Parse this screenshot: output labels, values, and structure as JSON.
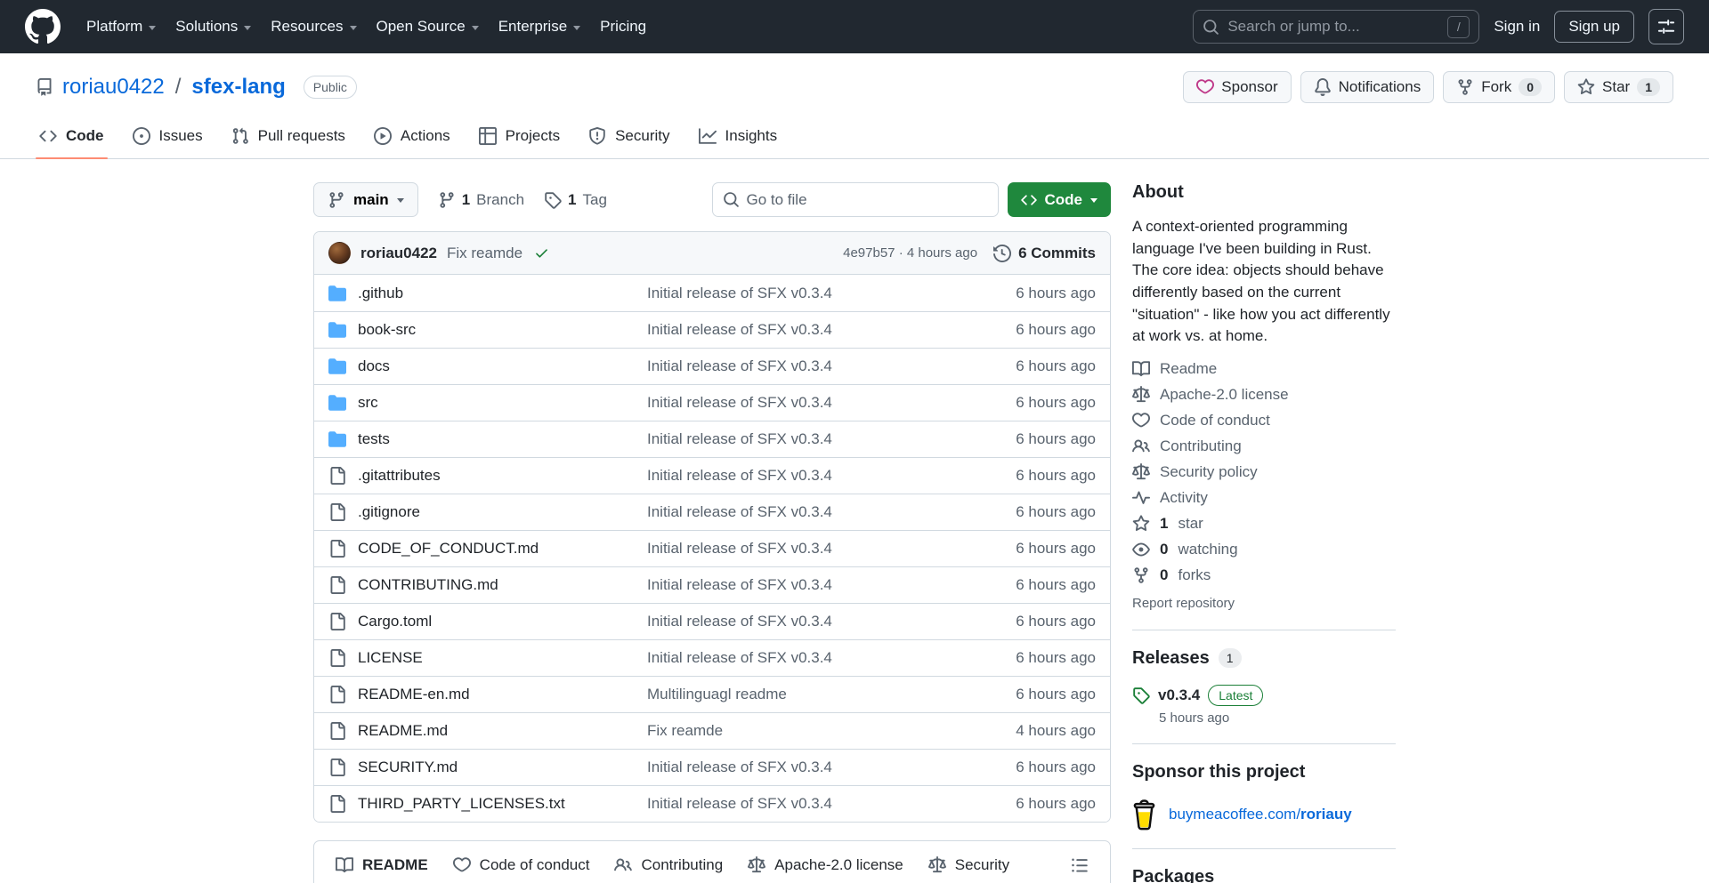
{
  "colors": {
    "header_bg": "#212830",
    "link_blue": "#0969da",
    "accent_green": "#1f883d",
    "success_green": "#1a7f37",
    "underline_orange": "#fd8c73",
    "folder_blue": "#54aeff",
    "sponsor_pink": "#bf3989",
    "coffee_yellow": "#ffdd00",
    "border_gray": "#d1d9e0",
    "muted_text": "#59636e"
  },
  "header": {
    "nav": [
      "Platform",
      "Solutions",
      "Resources",
      "Open Source",
      "Enterprise",
      "Pricing"
    ],
    "search_placeholder": "Search or jump to...",
    "search_shortcut": "/",
    "sign_in": "Sign in",
    "sign_up": "Sign up"
  },
  "repo_header": {
    "owner": "roriau0422",
    "slash": "/",
    "name": "sfex-lang",
    "visibility": "Public",
    "sponsor": "Sponsor",
    "notifications": "Notifications",
    "fork": "Fork",
    "fork_count": "0",
    "star": "Star",
    "star_count": "1"
  },
  "repo_tabs": [
    {
      "label": "Code"
    },
    {
      "label": "Issues"
    },
    {
      "label": "Pull requests"
    },
    {
      "label": "Actions"
    },
    {
      "label": "Projects"
    },
    {
      "label": "Security"
    },
    {
      "label": "Insights"
    }
  ],
  "toolbar": {
    "branch": "main",
    "branches_count": "1",
    "branches_label": "Branch",
    "tags_count": "1",
    "tags_label": "Tag",
    "go_to_file_placeholder": "Go to file",
    "code_button": "Code"
  },
  "commit_bar": {
    "author": "roriau0422",
    "message": "Fix reamde",
    "meta": "4e97b57 · 4 hours ago",
    "commits": "6 Commits"
  },
  "files": [
    {
      "name": ".github",
      "type": "folder",
      "message": "Initial release of SFX v0.3.4",
      "time": "6 hours ago"
    },
    {
      "name": "book-src",
      "type": "folder",
      "message": "Initial release of SFX v0.3.4",
      "time": "6 hours ago"
    },
    {
      "name": "docs",
      "type": "folder",
      "message": "Initial release of SFX v0.3.4",
      "time": "6 hours ago"
    },
    {
      "name": "src",
      "type": "folder",
      "message": "Initial release of SFX v0.3.4",
      "time": "6 hours ago"
    },
    {
      "name": "tests",
      "type": "folder",
      "message": "Initial release of SFX v0.3.4",
      "time": "6 hours ago"
    },
    {
      "name": ".gitattributes",
      "type": "file",
      "message": "Initial release of SFX v0.3.4",
      "time": "6 hours ago"
    },
    {
      "name": ".gitignore",
      "type": "file",
      "message": "Initial release of SFX v0.3.4",
      "time": "6 hours ago"
    },
    {
      "name": "CODE_OF_CONDUCT.md",
      "type": "file",
      "message": "Initial release of SFX v0.3.4",
      "time": "6 hours ago"
    },
    {
      "name": "CONTRIBUTING.md",
      "type": "file",
      "message": "Initial release of SFX v0.3.4",
      "time": "6 hours ago"
    },
    {
      "name": "Cargo.toml",
      "type": "file",
      "message": "Initial release of SFX v0.3.4",
      "time": "6 hours ago"
    },
    {
      "name": "LICENSE",
      "type": "file",
      "message": "Initial release of SFX v0.3.4",
      "time": "6 hours ago"
    },
    {
      "name": "README-en.md",
      "type": "file",
      "message": "Multilinguagl readme",
      "time": "6 hours ago"
    },
    {
      "name": "README.md",
      "type": "file",
      "message": "Fix reamde",
      "time": "4 hours ago"
    },
    {
      "name": "SECURITY.md",
      "type": "file",
      "message": "Initial release of SFX v0.3.4",
      "time": "6 hours ago"
    },
    {
      "name": "THIRD_PARTY_LICENSES.txt",
      "type": "file",
      "message": "Initial release of SFX v0.3.4",
      "time": "6 hours ago"
    }
  ],
  "readme_tabs": [
    {
      "label": "README"
    },
    {
      "label": "Code of conduct"
    },
    {
      "label": "Contributing"
    },
    {
      "label": "Apache-2.0 license"
    },
    {
      "label": "Security"
    }
  ],
  "sidebar": {
    "about_title": "About",
    "description": "A context-oriented programming language I've been building in Rust. The core idea: objects should behave differently based on the current \"situation\" - like how you act differently at work vs. at home.",
    "links": [
      "Readme",
      "Apache-2.0 license",
      "Code of conduct",
      "Contributing",
      "Security policy",
      "Activity"
    ],
    "stats": {
      "star_count": "1",
      "star_label": "star",
      "watch_count": "0",
      "watch_label": "watching",
      "fork_count": "0",
      "fork_label": "forks"
    },
    "report": "Report repository",
    "releases": {
      "title": "Releases",
      "count": "1",
      "version": "v0.3.4",
      "latest_label": "Latest",
      "time": "5 hours ago"
    },
    "sponsor": {
      "title": "Sponsor this project",
      "link_prefix": "buymeacoffee.com/",
      "link_user": "roriauy"
    },
    "packages_title": "Packages"
  }
}
